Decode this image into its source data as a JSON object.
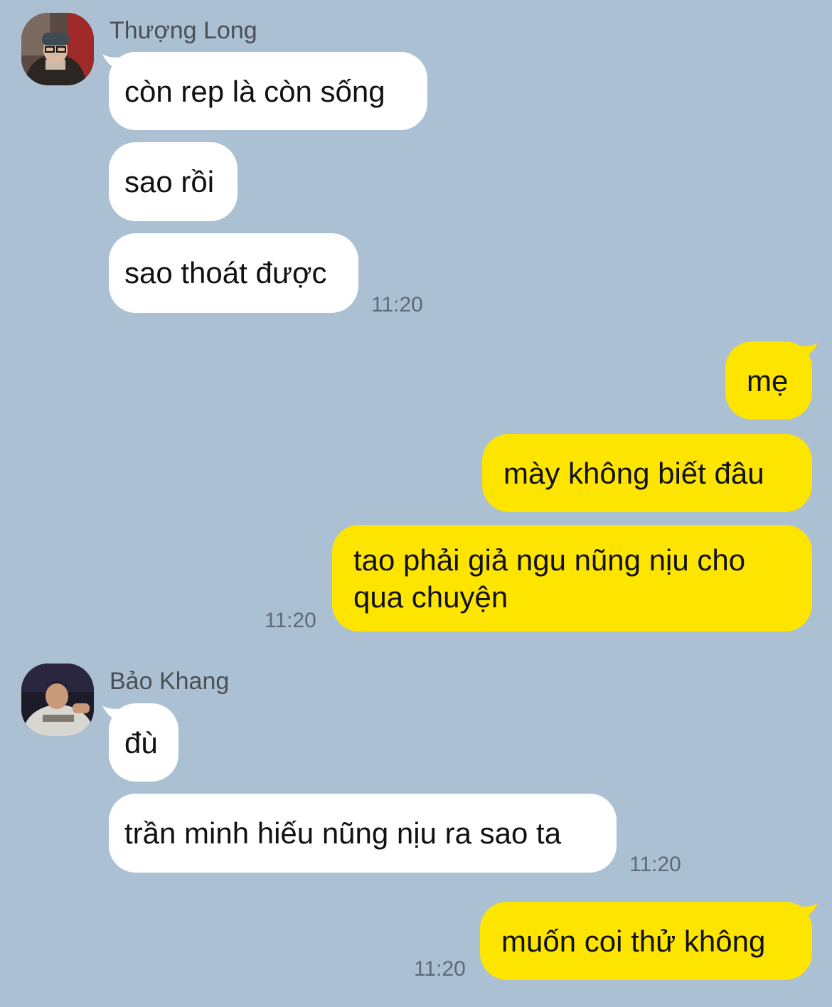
{
  "colors": {
    "background": "#abc1d3",
    "incoming_bubble": "#ffffff",
    "outgoing_bubble": "#fee500",
    "timestamp": "#5e6a76",
    "sender_name": "#4a4f55"
  },
  "conversation": [
    {
      "type": "incoming",
      "sender": "Thượng Long",
      "avatar": "user-photo-avatar",
      "messages": [
        "còn rep là còn sống",
        "sao rồi",
        "sao thoát được"
      ],
      "time": "11:20"
    },
    {
      "type": "outgoing",
      "messages": [
        "mẹ",
        "mày không biết đâu",
        "tao phải giả ngu nũng nịu cho qua chuyện"
      ],
      "time": "11:20"
    },
    {
      "type": "incoming",
      "sender": "Bảo Khang",
      "avatar": "user-photo-avatar",
      "messages": [
        "đù",
        "trần minh hiếu nũng nịu ra sao ta"
      ],
      "time": "11:20"
    },
    {
      "type": "outgoing",
      "messages": [
        "muốn coi thử không"
      ],
      "time": "11:20"
    }
  ]
}
